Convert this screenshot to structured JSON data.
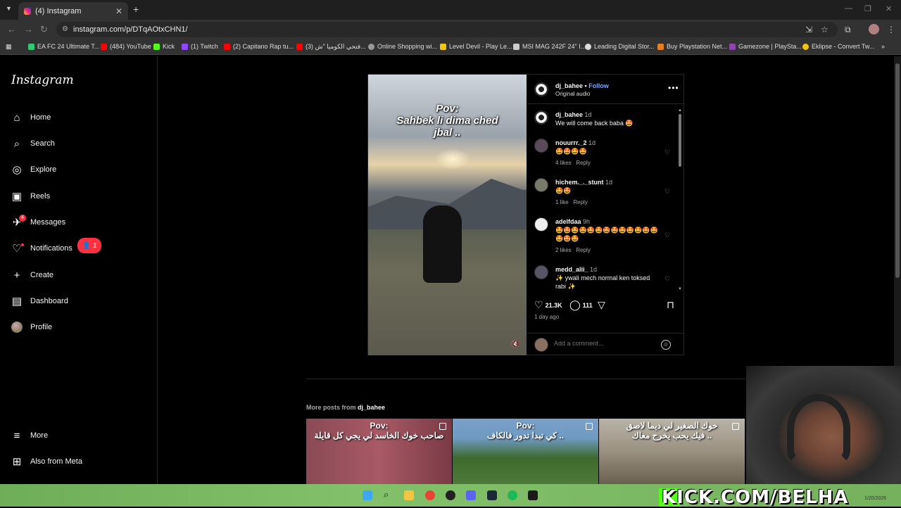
{
  "browser": {
    "tab_title": "(4) Instagram",
    "url": "instagram.com/p/DTqAOtxCHN1/",
    "bookmarks": [
      {
        "label": "EA FC 24 Ultimate T...",
        "color": "#2ecc71"
      },
      {
        "label": "(484) YouTube",
        "color": "#ff0000"
      },
      {
        "label": "Kick",
        "color": "#53fc18"
      },
      {
        "label": "(1) Twitch",
        "color": "#9146ff"
      },
      {
        "label": "(2) Capitano Rap tu...",
        "color": "#ff0000"
      },
      {
        "label": "(3) فتحي الكوميا \"ش...",
        "color": "#ff0000"
      },
      {
        "label": "Online Shopping wi...",
        "color": "#999999"
      },
      {
        "label": "Level Devil - Play Le...",
        "color": "#f1c40f"
      },
      {
        "label": "MSI MAG 242F 24\" I...",
        "color": "#cccccc"
      },
      {
        "label": "Leading Digital Stor...",
        "color": "#dddddd"
      },
      {
        "label": "Buy Playstation Net...",
        "color": "#e67e22"
      },
      {
        "label": "Gamezone | PlaySta...",
        "color": "#8e44ad"
      },
      {
        "label": "Eklipse - Convert Tw...",
        "color": "#f1c40f"
      }
    ]
  },
  "instagram": {
    "logo": "Instagram",
    "nav": {
      "home": "Home",
      "search": "Search",
      "explore": "Explore",
      "reels": "Reels",
      "messages": "Messages",
      "messages_badge": "4",
      "notifications": "Notifications",
      "notifications_count": "1",
      "create": "Create",
      "dashboard": "Dashboard",
      "profile": "Profile",
      "more": "More",
      "also_from_meta": "Also from Meta"
    },
    "post": {
      "caption_overlay": "Pov:\nSahbek li dima ched\njbal ..",
      "username": "dj_bahee",
      "separator": "•",
      "follow_label": "Follow",
      "audio": "Original audio",
      "likes": "21.3K",
      "comments_count": "111",
      "posted": "1 day ago",
      "comment_placeholder": "Add a comment...",
      "comments": [
        {
          "user": "dj_bahee",
          "time": "1d",
          "text": "We will come back baba 🤩",
          "likes": "",
          "reply": ""
        },
        {
          "user": "nouurrr._2",
          "time": "1d",
          "text": "🤩🤩🤩🤩",
          "likes": "4 likes",
          "reply": "Reply"
        },
        {
          "user": "hichem._._stunt",
          "time": "1d",
          "text": "🤩🤩",
          "likes": "1 like",
          "reply": "Reply"
        },
        {
          "user": "adelfdaa",
          "time": "9h",
          "text": "🤩🤩🤩🤩🤩🤩🤩🤩🤩🤩🤩🤩🤩🤩🤩🤩",
          "likes": "2 likes",
          "reply": "Reply"
        },
        {
          "user": "medd_alii_",
          "time": "1d",
          "text": "✨ ywali mech normal ken toksed rabi ✨",
          "likes": "",
          "reply": ""
        }
      ]
    },
    "more_posts": {
      "label": "More posts from",
      "user": "dj_bahee",
      "thumbs": [
        {
          "title": "Pov:\nصاحب خوك الخاسد لي يجي كل قايلة",
          "color": "#8a4a55"
        },
        {
          "title": "Pov:\nكي تبدا تدور فالكاف ..",
          "color": "#4d7a3a"
        },
        {
          "title": "خوك الصغير لي ديما لاصق\nفيك يحب يخرج معاك ..",
          "color": "#9a9080"
        }
      ]
    }
  },
  "overlay": {
    "stream_text": "KICK.COM/BELHA",
    "clock": "1/20/2026"
  }
}
